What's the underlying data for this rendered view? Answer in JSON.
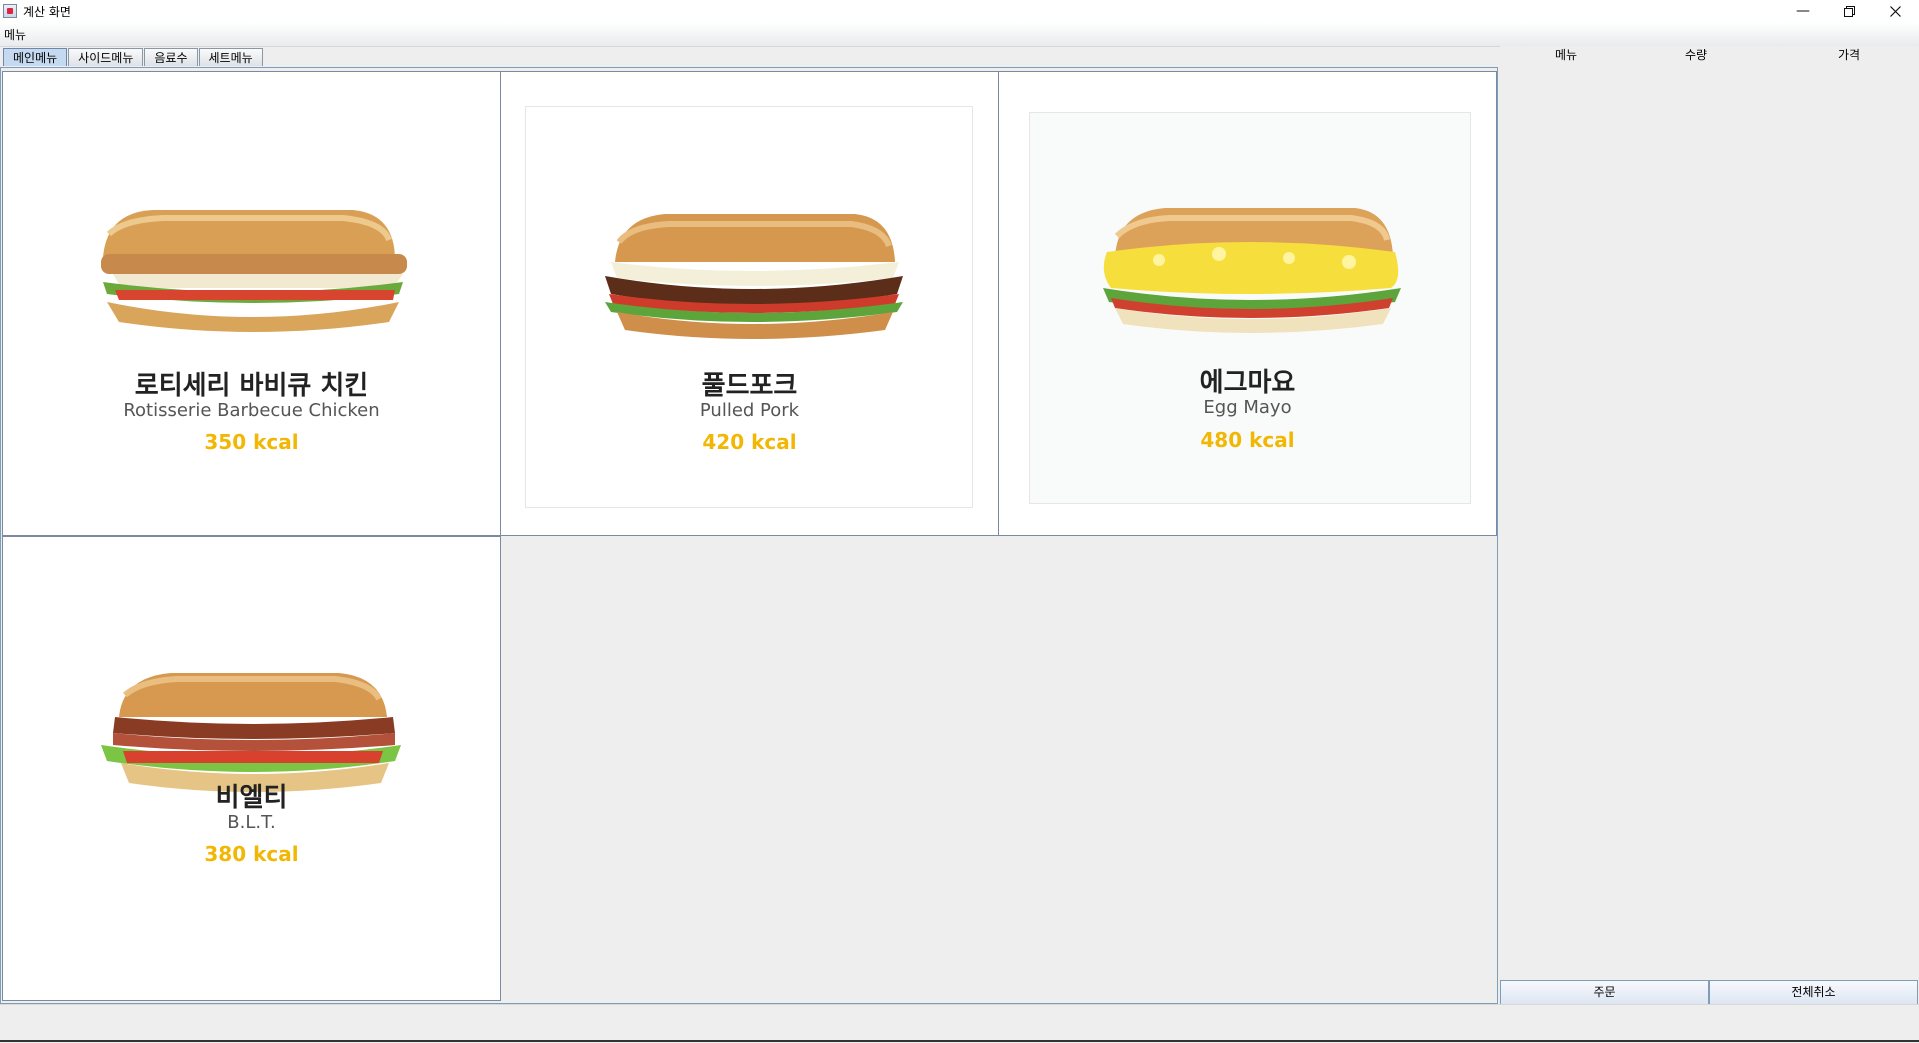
{
  "window": {
    "title": "계산 화면"
  },
  "menubar": {
    "menu_label": "메뉴"
  },
  "tabs": [
    {
      "label": "메인메뉴",
      "active": true
    },
    {
      "label": "사이드메뉴",
      "active": false
    },
    {
      "label": "음료수",
      "active": false
    },
    {
      "label": "세트메뉴",
      "active": false
    }
  ],
  "products": [
    {
      "name_ko": "로티세리 바비큐 치킨",
      "name_en": "Rotisserie Barbecue Chicken",
      "kcal": "350 kcal"
    },
    {
      "name_ko": "풀드포크",
      "name_en": "Pulled Pork",
      "kcal": "420 kcal"
    },
    {
      "name_ko": "에그마요",
      "name_en": "Egg Mayo",
      "kcal": "480 kcal"
    },
    {
      "name_ko": "비엘티",
      "name_en": "B.L.T.",
      "kcal": "380 kcal"
    }
  ],
  "order": {
    "columns": [
      "메뉴",
      "수량",
      "가격"
    ],
    "order_button": "주문",
    "cancel_all_button": "전체취소"
  },
  "colors": {
    "kcal": "#f2b705",
    "tab_active": "#c5daf0"
  }
}
